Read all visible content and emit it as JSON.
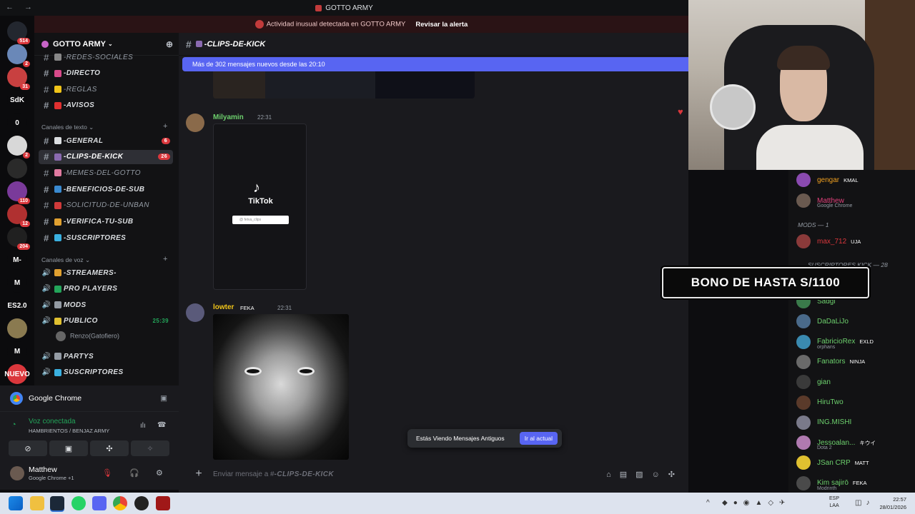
{
  "window": {
    "title": "GOTTO ARMY",
    "nav": "← →"
  },
  "alert": {
    "text": "Actividad inusual detectada en GOTTO ARMY",
    "action": "Revisar la alerta"
  },
  "rail": [
    {
      "label": "",
      "badge": "514",
      "color": "#23272f"
    },
    {
      "label": "",
      "badge": "2",
      "color": "#6a88b8"
    },
    {
      "label": "",
      "badge": "31",
      "color": "#c84040"
    },
    {
      "label": "SdK",
      "badge": "",
      "color": "#0b0b0d"
    },
    {
      "label": "0",
      "badge": "",
      "color": "#0b0b0d"
    },
    {
      "label": "",
      "badge": "2",
      "color": "#d8d8d8"
    },
    {
      "label": "",
      "badge": "",
      "color": "#2a2a2a"
    },
    {
      "label": "",
      "badge": "110",
      "color": "#7a3a9a"
    },
    {
      "label": "",
      "badge": "12",
      "color": "#b03030"
    },
    {
      "label": "",
      "badge": "204",
      "color": "#202020"
    },
    {
      "label": "M-",
      "badge": "",
      "color": "#0b0b0d"
    },
    {
      "label": "M",
      "badge": "",
      "color": "#0b0b0d"
    },
    {
      "label": "ES2.0",
      "badge": "",
      "color": "#0b0b0d"
    },
    {
      "label": "",
      "badge": "",
      "color": "#8a7a50"
    },
    {
      "label": "M",
      "badge": "",
      "color": "#0b0b0d"
    },
    {
      "label": "NUEVO",
      "badge": "",
      "color": "#da373c"
    }
  ],
  "guild": {
    "name": "GOTTO ARMY"
  },
  "channels_top": [
    {
      "name": "-REDES-SOCIALES",
      "emoji": "#888888",
      "muted": true
    },
    {
      "name": "-DIRECTO",
      "emoji": "#d84a8a",
      "muted": false
    },
    {
      "name": "-REGLAS",
      "emoji": "#f0c419",
      "muted": true
    },
    {
      "name": "-AVISOS",
      "emoji": "#e03030",
      "muted": false
    }
  ],
  "text_category": "Canales de texto",
  "text_channels": [
    {
      "name": "-GENERAL",
      "emoji": "#dbdee1",
      "count": "6",
      "muted": false,
      "active": false
    },
    {
      "name": "-CLIPS-DE-KICK",
      "emoji": "#8a6ab0",
      "count": "26",
      "muted": false,
      "active": true
    },
    {
      "name": "-MEMES-DEL-GOTTO",
      "emoji": "#e07aa0",
      "count": "",
      "muted": true,
      "active": false
    },
    {
      "name": "-BENEFICIOS-DE-SUB",
      "emoji": "#3a8ad0",
      "count": "",
      "muted": false,
      "active": false
    },
    {
      "name": "-SOLICITUD-DE-UNBAN",
      "emoji": "#d03a3a",
      "count": "",
      "muted": true,
      "active": false
    },
    {
      "name": "-VERIFICA-TU-SUB",
      "emoji": "#e0a030",
      "count": "",
      "muted": false,
      "active": false
    },
    {
      "name": "-SUSCRIPTORES",
      "emoji": "#3ab0e0",
      "count": "",
      "muted": false,
      "active": false
    }
  ],
  "voice_category": "Canales de voz",
  "voice_channels": [
    {
      "name": "-STREAMERS-",
      "emoji": "#e0a030",
      "time": ""
    },
    {
      "name": "PRO PLAYERS",
      "emoji": "#23a55a",
      "time": ""
    },
    {
      "name": "MODS",
      "emoji": "#949ba4",
      "time": ""
    },
    {
      "name": "PUBLICO",
      "emoji": "#e0c030",
      "time": "25:39"
    }
  ],
  "voice_user": "Renzo(Gatofiero)",
  "voice_channels2": [
    {
      "name": "PARTYS",
      "emoji": "#949ba4"
    },
    {
      "name": "SUSCRIPTORES",
      "emoji": "#3ab0e0"
    }
  ],
  "activity": {
    "app": "Google Chrome"
  },
  "voice": {
    "status": "Voz conectada",
    "server": "HAMBRIENTOS / BENJAZ ARMY"
  },
  "user": {
    "name": "Matthew",
    "status": "Google Chrome +1"
  },
  "chat": {
    "channel": "-CLIPS-DE-KICK",
    "new_banner": "Más de 302 mensajes nuevos desde las 20:10",
    "messages": [
      {
        "author": "Milyamin",
        "color": "#6dd06d",
        "time": "22:31",
        "tag": ""
      },
      {
        "author": "lowter",
        "color": "#f0c419",
        "time": "22:31",
        "tag": "FEKA"
      }
    ],
    "tiktok_label": "TikTok",
    "tiktok_search": "@ fetva_clips",
    "old_notice": "Estás Viendo Mensajes Antiguos",
    "jump": "Ir al actual",
    "composer_prefix": "Enviar mensaje a #",
    "composer_channel": "-CLIPS-DE-KICK"
  },
  "members": {
    "top": [
      {
        "name": "gengar",
        "color": "#f0a020",
        "tag": "KMAL",
        "sub": "",
        "av": "#8a4ab0"
      },
      {
        "name": "Matthew",
        "color": "#e0407a",
        "tag": "",
        "sub": "Google Chrome",
        "av": "#6a5a50"
      }
    ],
    "mods_label": "MODS — 1",
    "mods": [
      {
        "name": "max_712",
        "color": "#da373c",
        "tag": "UJA",
        "sub": "",
        "av": "#8a3a3a"
      }
    ],
    "subs_label": "SUSCRIPTORES KICK — 28",
    "subs": [
      {
        "name": "Sadgi",
        "color": "#6dd06d",
        "tag": "",
        "sub": "",
        "av": "#3a7a4a"
      },
      {
        "name": "DaDaLiJo",
        "color": "#6dd06d",
        "tag": "",
        "sub": "",
        "av": "#4a6a8a"
      },
      {
        "name": "FabricioRex",
        "color": "#6dd06d",
        "tag": "EXLD",
        "sub": "orphans",
        "av": "#3a8ab0"
      },
      {
        "name": "Fanators",
        "color": "#6dd06d",
        "tag": "NINJA",
        "sub": "",
        "av": "#6a6a6a"
      },
      {
        "name": "gian",
        "color": "#6dd06d",
        "tag": "",
        "sub": "",
        "av": "#3a3a3a"
      },
      {
        "name": "HiruTwo",
        "color": "#6dd06d",
        "tag": "",
        "sub": "",
        "av": "#5a3a2a"
      },
      {
        "name": "ING.MISHI",
        "color": "#6dd06d",
        "tag": "",
        "sub": "",
        "av": "#7a7a8a"
      },
      {
        "name": "Jessoalan...",
        "color": "#6dd06d",
        "tag": "キウイ",
        "sub": "Dota 2",
        "av": "#b07ab0"
      },
      {
        "name": "JSan CRP",
        "color": "#6dd06d",
        "tag": "MATT",
        "sub": "",
        "av": "#e0c030"
      },
      {
        "name": "Kim sajirō",
        "color": "#6dd06d",
        "tag": "FEKA",
        "sub": "Modrinth",
        "av": "#4a4a4a"
      }
    ]
  },
  "promo": "BONO DE HASTA S/1100",
  "taskbar": {
    "lang1": "ESP",
    "lang2": "LAA",
    "time": "22:57",
    "date": "28/01/2026"
  }
}
